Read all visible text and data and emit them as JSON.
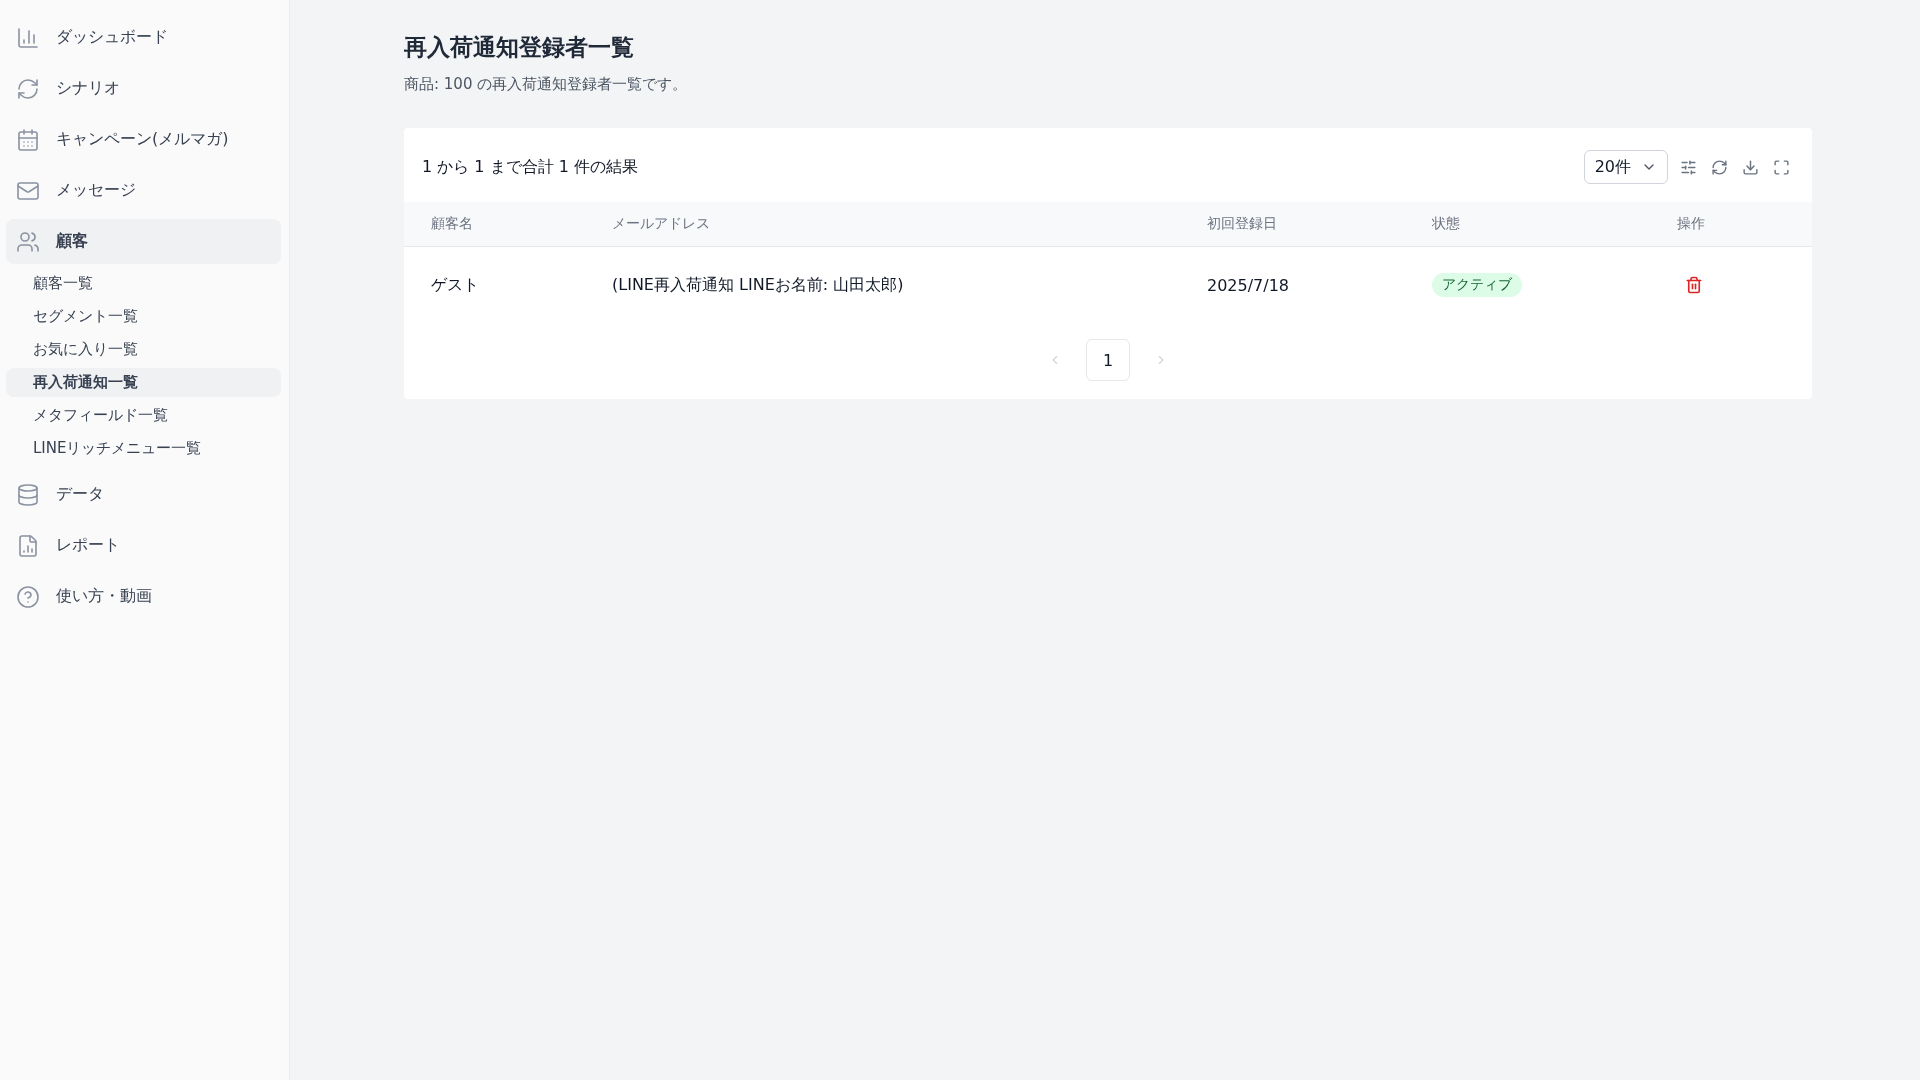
{
  "sidebar": {
    "items": [
      {
        "label": "ダッシュボード",
        "selected": false
      },
      {
        "label": "シナリオ",
        "selected": false
      },
      {
        "label": "キャンペーン(メルマガ)",
        "selected": false
      },
      {
        "label": "メッセージ",
        "selected": false
      },
      {
        "label": "顧客",
        "selected": true,
        "children": [
          {
            "label": "顧客一覧",
            "selected": false
          },
          {
            "label": "セグメント一覧",
            "selected": false
          },
          {
            "label": "お気に入り一覧",
            "selected": false
          },
          {
            "label": "再入荷通知一覧",
            "selected": true
          },
          {
            "label": "メタフィールド一覧",
            "selected": false
          },
          {
            "label": "LINEリッチメニュー一覧",
            "selected": false
          }
        ]
      },
      {
        "label": "データ",
        "selected": false
      },
      {
        "label": "レポート",
        "selected": false
      },
      {
        "label": "使い方・動画",
        "selected": false
      }
    ]
  },
  "page": {
    "title": "再入荷通知登録者一覧",
    "subtitle": "商品: 100 の再入荷通知登録者一覧です。"
  },
  "table_card": {
    "summary": "1 から 1 まで合計 1 件の結果",
    "page_size": "20件",
    "columns": [
      "顧客名",
      "メールアドレス",
      "初回登録日",
      "状態",
      "操作"
    ],
    "rows": [
      {
        "name": "ゲスト",
        "email": "(LINE再入荷通知 LINEお名前: 山田太郎)",
        "registered": "2025/7/18",
        "status": {
          "label": "アクティブ",
          "kind": "active"
        }
      }
    ],
    "pagination": {
      "prev_disabled": true,
      "next_disabled": true,
      "pages": [
        {
          "label": "1",
          "selected": true
        }
      ]
    }
  }
}
